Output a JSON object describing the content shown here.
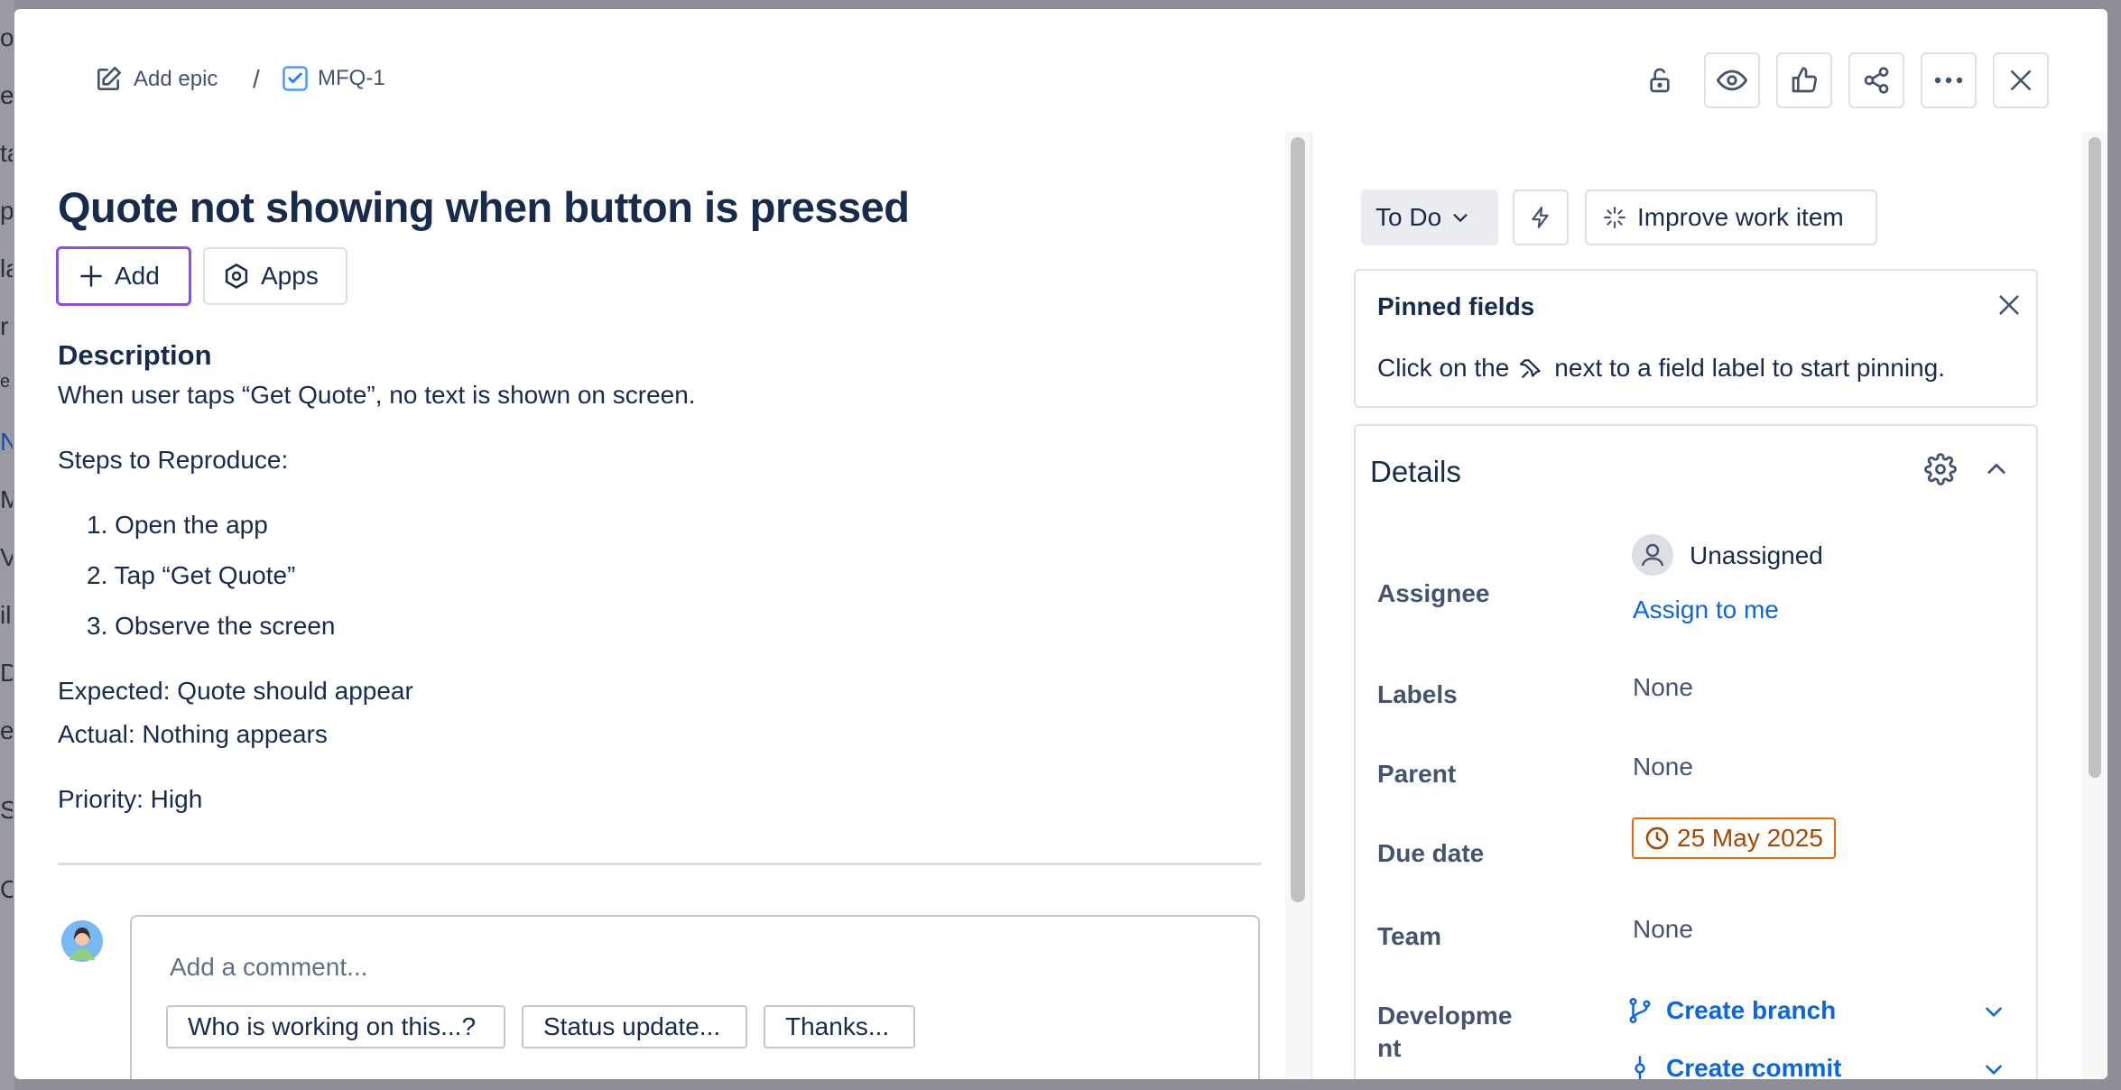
{
  "breadcrumb": {
    "add_epic": "Add epic",
    "separator": "/",
    "issue_key": "MFQ-1"
  },
  "issue": {
    "title": "Quote not showing when button is pressed",
    "add_label": "Add",
    "apps_label": "Apps"
  },
  "description": {
    "heading": "Description",
    "line1": "When user taps “Get Quote”, no text is shown on screen.",
    "steps_heading": "Steps to Reproduce:",
    "steps": [
      "1. Open the app",
      "2. Tap “Get Quote”",
      "3. Observe the screen"
    ],
    "expected": "Expected: Quote should appear",
    "actual": "Actual: Nothing appears",
    "priority": "Priority: High"
  },
  "comment": {
    "placeholder": "Add a comment...",
    "chips": [
      "Who is working on this...?",
      "Status update...",
      "Thanks..."
    ]
  },
  "side": {
    "status": "To Do",
    "improve": "Improve work item",
    "pinned_title": "Pinned fields",
    "pinned_pre": "Click on the",
    "pinned_post": "next to a field label to start pinning.",
    "details_title": "Details",
    "fields": {
      "assignee_label": "Assignee",
      "assignee_value": "Unassigned",
      "assign_to_me": "Assign to me",
      "labels_label": "Labels",
      "labels_value": "None",
      "parent_label": "Parent",
      "parent_value": "None",
      "due_label": "Due date",
      "due_value": "25 May 2025",
      "team_label": "Team",
      "team_value": "None",
      "dev_label_1": "Developme",
      "dev_label_2": "nt",
      "create_branch": "Create branch",
      "create_commit": "Create commit"
    }
  },
  "background_letters": [
    "o",
    "e",
    "ta",
    "p",
    "la",
    "r",
    "e",
    "N",
    "M",
    "V",
    "il",
    "Da",
    "e",
    "Sc",
    "Cu"
  ],
  "colors": {
    "link": "#0c66e4",
    "text": "#172b4d",
    "subtle": "#44546f",
    "add_button_border": "#8f4fe0",
    "due_border": "#e56910",
    "due_text": "#a54800"
  }
}
